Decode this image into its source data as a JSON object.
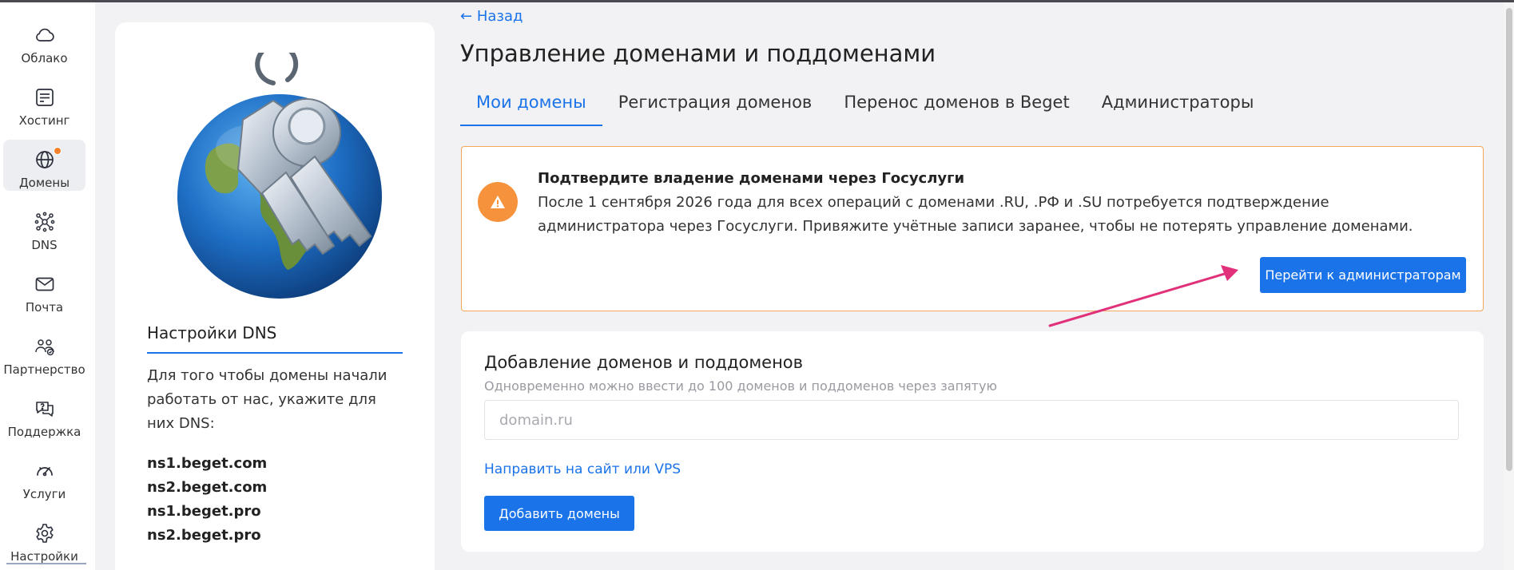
{
  "sidebar": {
    "items": [
      {
        "label": "Облако",
        "icon": "cloud-icon"
      },
      {
        "label": "Хостинг",
        "icon": "server-icon"
      },
      {
        "label": "Домены",
        "icon": "globe-icon",
        "active": true,
        "notification": true
      },
      {
        "label": "DNS",
        "icon": "dns-network-icon"
      },
      {
        "label": "Почта",
        "icon": "mail-icon"
      },
      {
        "label": "Партнерство",
        "icon": "partners-icon"
      },
      {
        "label": "Поддержка",
        "icon": "support-chat-icon"
      },
      {
        "label": "Услуги",
        "icon": "services-gauge-icon"
      },
      {
        "label": "Настройки",
        "icon": "gear-icon"
      }
    ]
  },
  "left_panel": {
    "dns_title": "Настройки DNS",
    "dns_description": "Для того чтобы домены начали работать от нас, укажите для них DNS:",
    "nameservers": [
      "ns1.beget.com",
      "ns2.beget.com",
      "ns1.beget.pro",
      "ns2.beget.pro"
    ]
  },
  "header": {
    "back_label": "Назад",
    "title": "Управление доменами и поддоменами"
  },
  "tabs": [
    {
      "label": "Мои домены",
      "active": true
    },
    {
      "label": "Регистрация доменов"
    },
    {
      "label": "Перенос доменов в Beget"
    },
    {
      "label": "Администраторы"
    }
  ],
  "alert": {
    "title": "Подтвердите владение доменами через Госуслуги",
    "text": "После 1 сентября 2026 года для всех операций с доменами .RU, .РФ и .SU потребуется подтверждение администратора через Госуслуги. Привяжите учётные записи заранее, чтобы не потерять управление доменами.",
    "button_label": "Перейти к администраторам"
  },
  "add_domains": {
    "title": "Добавление доменов и поддоменов",
    "subtitle": "Одновременно можно ввести до 100 доменов и поддоменов через запятую",
    "placeholder": "domain.ru",
    "redirect_link": "Направить на сайт или VPS",
    "button_label": "Добавить домены"
  },
  "colors": {
    "accent": "#1a73e8",
    "warning": "#f6923b",
    "annotation_arrow": "#e0317a"
  }
}
